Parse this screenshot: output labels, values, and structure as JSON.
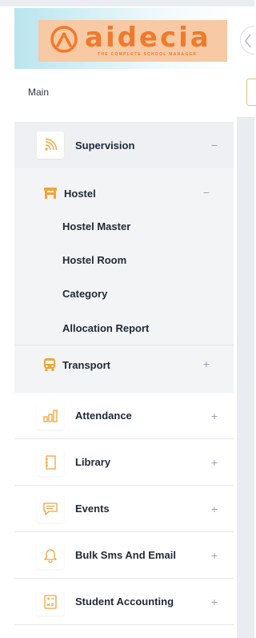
{
  "brand": {
    "name": "aidecia",
    "tagline": "THE COMPLETE SCHOOL MANAGER",
    "color": "#ef7a2b"
  },
  "sidebar": {
    "section_label": "Main",
    "supervision": {
      "label": "Supervision",
      "sign": "−",
      "icon": "rss-icon",
      "hostel": {
        "label": "Hostel",
        "sign": "−",
        "icon": "hostel-icon",
        "items": [
          "Hostel Master",
          "Hostel Room",
          "Category",
          "Allocation Report"
        ]
      },
      "transport": {
        "label": "Transport",
        "sign": "+",
        "icon": "bus-icon"
      }
    },
    "items": [
      {
        "label": "Attendance",
        "sign": "+",
        "icon": "bar-chart-icon"
      },
      {
        "label": "Library",
        "sign": "+",
        "icon": "notebook-icon"
      },
      {
        "label": "Events",
        "sign": "+",
        "icon": "message-icon"
      },
      {
        "label": "Bulk Sms And Email",
        "sign": "+",
        "icon": "bell-icon"
      },
      {
        "label": "Student Accounting",
        "sign": "+",
        "icon": "calculator-icon"
      }
    ]
  },
  "colors": {
    "accent": "#f0a43a",
    "header_gradient": "#b9e5ef"
  }
}
